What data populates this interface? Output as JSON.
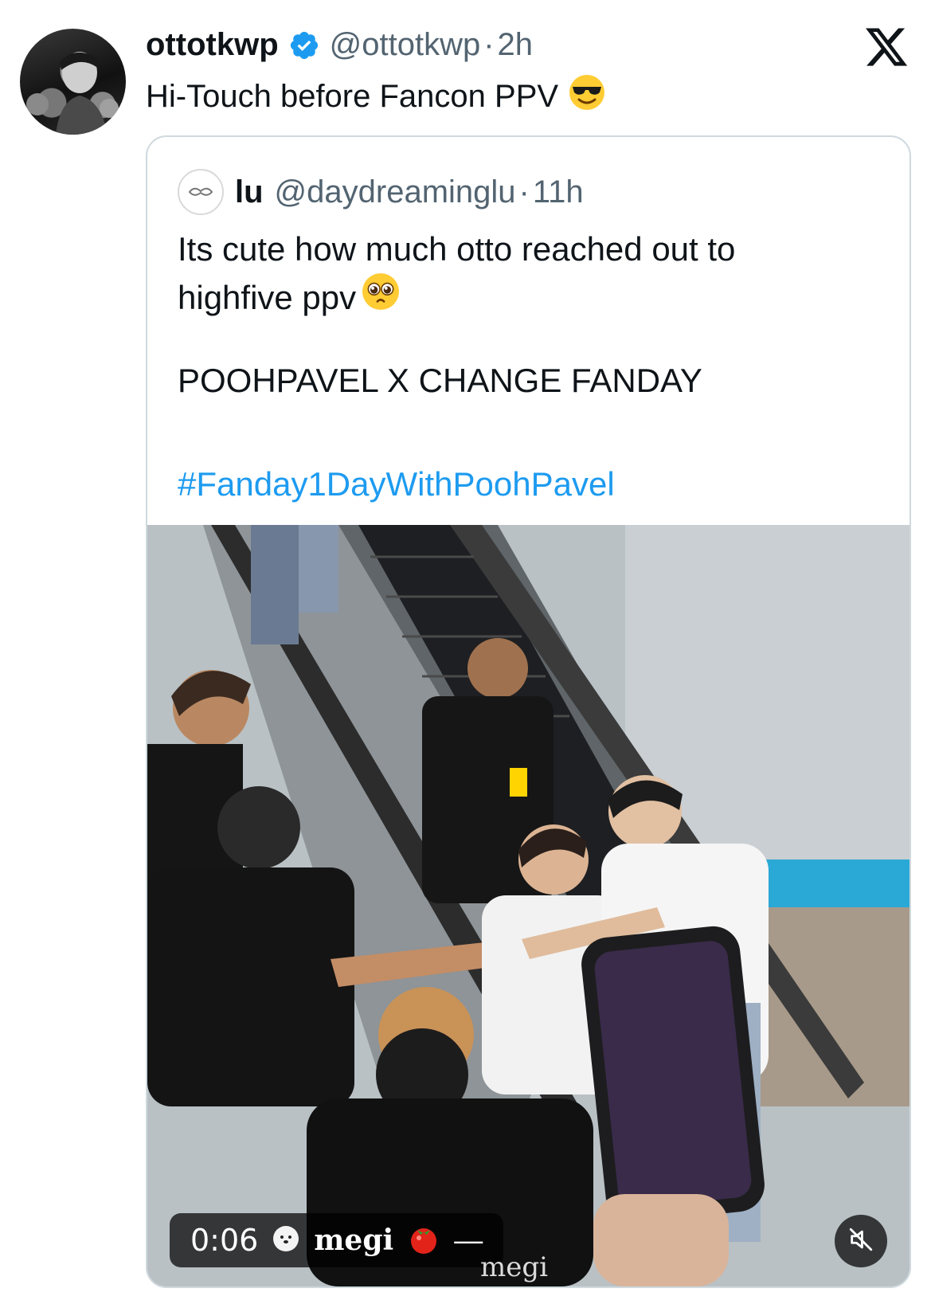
{
  "post": {
    "author_name": "ottotkwp",
    "handle": "@ottotkwp",
    "separator": "·",
    "time": "2h",
    "text": "Hi-Touch before Fancon PPV",
    "emoji": "smiling-face-with-sunglasses-icon"
  },
  "quoted_post": {
    "author_name": "lu",
    "handle": "@daydreaminglu",
    "separator": "·",
    "time": "11h",
    "line1": "Its cute how much otto reached out to",
    "line2": "highfive ppv",
    "emoji": "pleading-face-icon",
    "paragraph2": "POOHPAVEL X CHANGE FANDAY",
    "hashtag": "#Fanday1DayWithPoohPavel"
  },
  "video": {
    "timestamp": "0:06",
    "channel_name": "megi",
    "separator": "—",
    "watermark": "megi",
    "mute_icon": "muted-speaker-icon"
  },
  "colors": {
    "verified": "#1d9bf0",
    "hashtag": "#1d9bf0",
    "secondary_text": "#536471",
    "border": "#cfd9de"
  }
}
